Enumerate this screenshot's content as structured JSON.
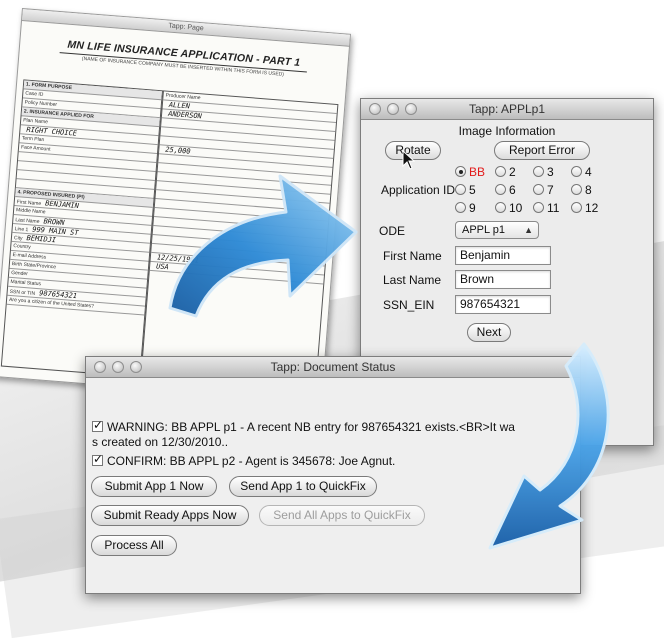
{
  "paper_form": {
    "window_title": "Tapp: Page",
    "title": "MN LIFE INSURANCE APPLICATION - PART 1",
    "subtitle": "(NAME OF INSURANCE COMPANY MUST BE INSERTED WITHIN THIS FORM IS USED)",
    "lines": [
      "1. FORM PURPOSE",
      "Producer Name",
      "Case ID",
      "Policy Number",
      "2. INSURANCE APPLIED FOR",
      "Plan Name",
      "Term Plan",
      "Face Amount",
      "4. PROPOSED INSURED (PI)",
      "First Name",
      "Middle Name",
      "Last Name",
      "Line 1",
      "City",
      "Country",
      "E-mail Address",
      "Birth State/Province",
      "Gender",
      "Marital Status",
      "SSN or TIN",
      "Are you a citizen of the United States?"
    ],
    "handwriting": {
      "first_name": "ALLEN",
      "last_name": "ANDERSON",
      "plan": "RIGHT CHOICE",
      "amount": "25,000",
      "pi_first": "BENJAMIN",
      "pi_last": "BROWN",
      "street": "999 MAIN ST",
      "city": "BEMIDJI",
      "birth": "12/25/1981",
      "country": "USA",
      "ssn": "987654321"
    }
  },
  "app_window": {
    "title": "Tapp: APPLp1",
    "section_title": "Image Information",
    "rotate_label": "Rotate",
    "report_error_label": "Report Error",
    "application_id_label": "Application ID",
    "radios": [
      {
        "label": "BB",
        "selected": true
      },
      {
        "label": "2",
        "selected": false
      },
      {
        "label": "3",
        "selected": false
      },
      {
        "label": "4",
        "selected": false
      },
      {
        "label": "5",
        "selected": false
      },
      {
        "label": "6",
        "selected": false
      },
      {
        "label": "7",
        "selected": false
      },
      {
        "label": "8",
        "selected": false
      },
      {
        "label": "9",
        "selected": false
      },
      {
        "label": "10",
        "selected": false
      },
      {
        "label": "11",
        "selected": false
      },
      {
        "label": "12",
        "selected": false
      }
    ],
    "code_label": "ODE",
    "code_value": "APPL p1",
    "first_name_label": "First Name",
    "first_name_value": "Benjamin",
    "last_name_label": "Last Name",
    "last_name_value": "Brown",
    "ssn_label": "SSN_EIN",
    "ssn_value": "987654321",
    "next_label": "Next"
  },
  "status_window": {
    "title": "Tapp: Document Status",
    "messages": [
      {
        "line1": "WARNING: BB APPL p1 - A recent NB entry for 987654321 exists.<BR>It wa",
        "line2": "s created on 12/30/2010..",
        "checked": true
      },
      {
        "line1": "CONFIRM: BB APPL p2 - Agent is 345678: Joe Agnut.",
        "line2": "",
        "checked": true
      }
    ],
    "buttons": {
      "submit_app1": "Submit App 1 Now",
      "send_app1": "Send App 1 to QuickFix",
      "submit_ready": "Submit Ready Apps Now",
      "send_all": "Send All Apps to QuickFix",
      "process_all": "Process All"
    }
  },
  "colors": {
    "arrow_blue": "#2a7fc6",
    "arrow_light": "#9fd3f5",
    "selected_radio_text": "#e21b1b"
  }
}
